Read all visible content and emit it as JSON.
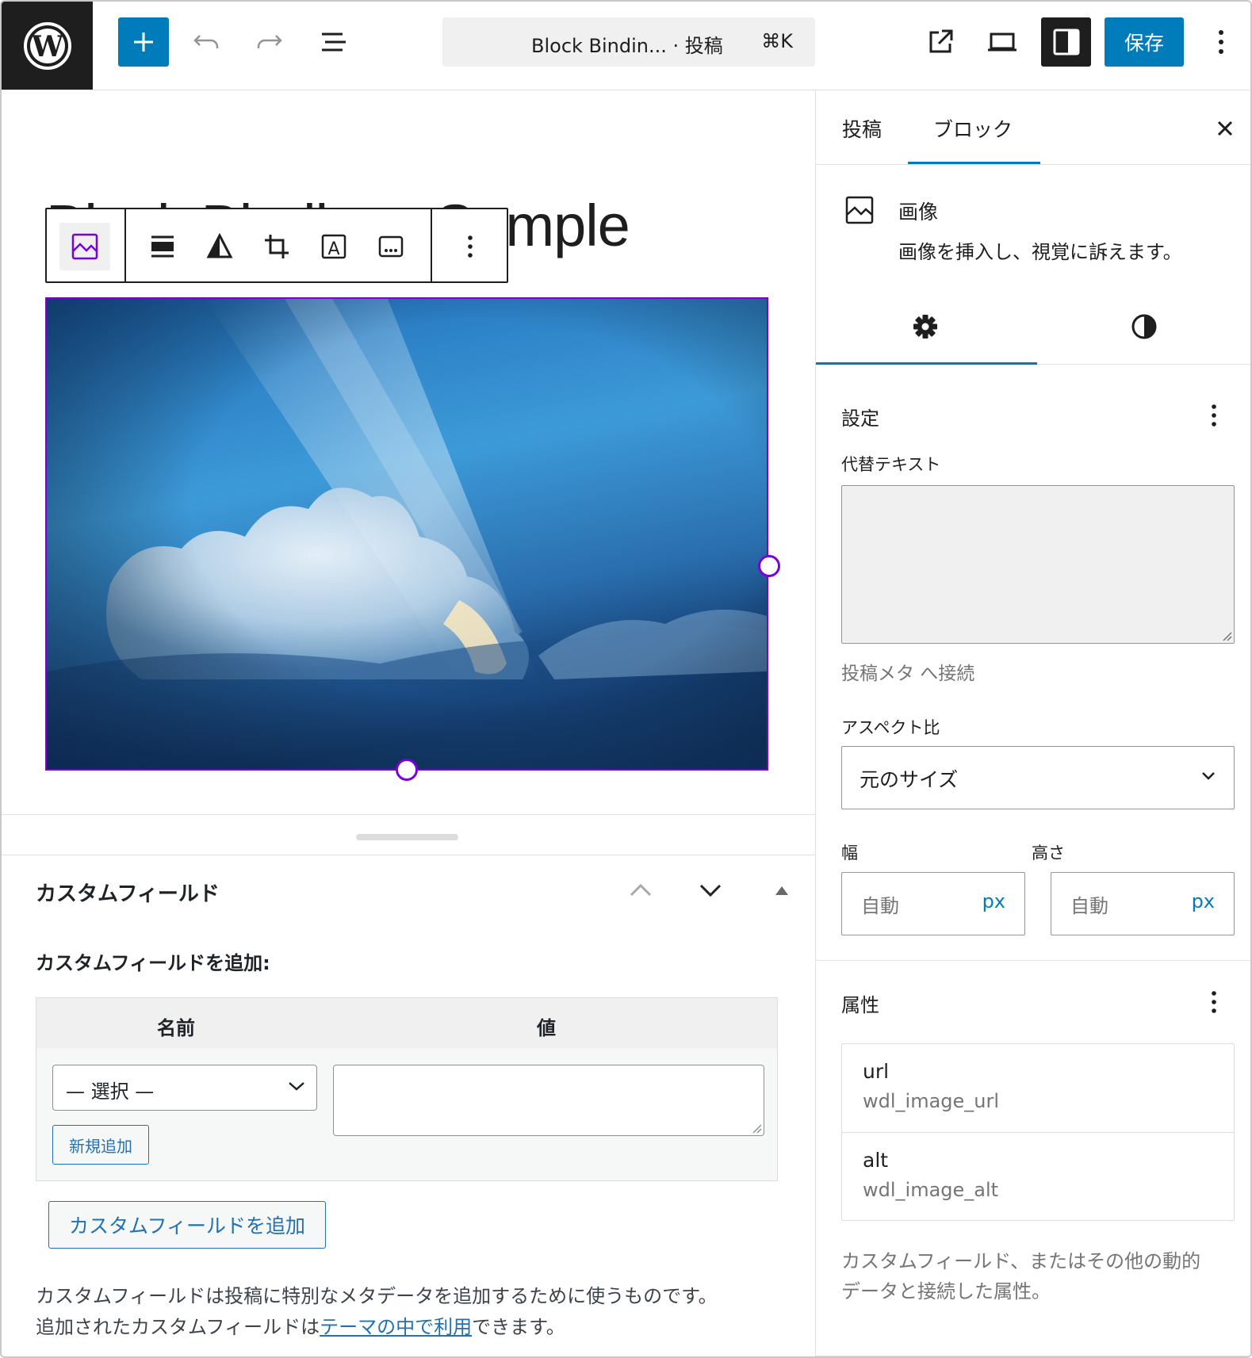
{
  "topbar": {
    "command_title": "Block Bindin... · 投稿",
    "command_shortcut": "⌘K",
    "save_label": "保存"
  },
  "canvas": {
    "post_title": "Block Bindings Sample"
  },
  "custom_fields": {
    "title": "カスタムフィールド",
    "subtitle": "カスタムフィールドを追加:",
    "col_name": "名前",
    "col_value": "値",
    "select_value": "— 選択 —",
    "new_button": "新規追加",
    "add_button": "カスタムフィールドを追加",
    "desc_line1": "カスタムフィールドは投稿に特別なメタデータを追加するために使うものです。",
    "desc_line2_prefix": "追加されたカスタムフィールドは",
    "desc_link": "テーマの中で利用",
    "desc_line2_suffix": "できます。"
  },
  "sidebar": {
    "tabs": [
      {
        "label": "投稿"
      },
      {
        "label": "ブロック"
      }
    ],
    "block_card": {
      "title": "画像",
      "description": "画像を挿入し、視覚に訴えます。"
    },
    "settings": {
      "title": "設定",
      "alt_label": "代替テキスト",
      "alt_help": "投稿メタ へ接続",
      "aspect_label": "アスペクト比",
      "aspect_value": "元のサイズ",
      "width_label": "幅",
      "height_label": "高さ",
      "width_placeholder": "自動",
      "height_placeholder": "自動",
      "unit": "px"
    },
    "attributes": {
      "title": "属性",
      "items": [
        {
          "name": "url",
          "field": "wdl_image_url"
        },
        {
          "name": "alt",
          "field": "wdl_image_alt"
        }
      ],
      "help_line1": "カスタムフィールド、またはその他の動的",
      "help_line2": "データと接続した属性。"
    }
  },
  "colors": {
    "accent": "#007cba",
    "selection": "#7a00df",
    "dark": "#1e1e1e",
    "wp_link": "#2271b1"
  },
  "icons": {
    "logo": "wordpress-logo-icon",
    "add": "plus-icon",
    "undo": "undo-icon",
    "redo": "redo-icon",
    "outline": "document-overview-icon",
    "view": "external-link-icon",
    "preview": "desktop-preview-icon",
    "settings_toggle": "sidebar-toggle-icon",
    "options": "vertical-ellipsis-icon"
  }
}
